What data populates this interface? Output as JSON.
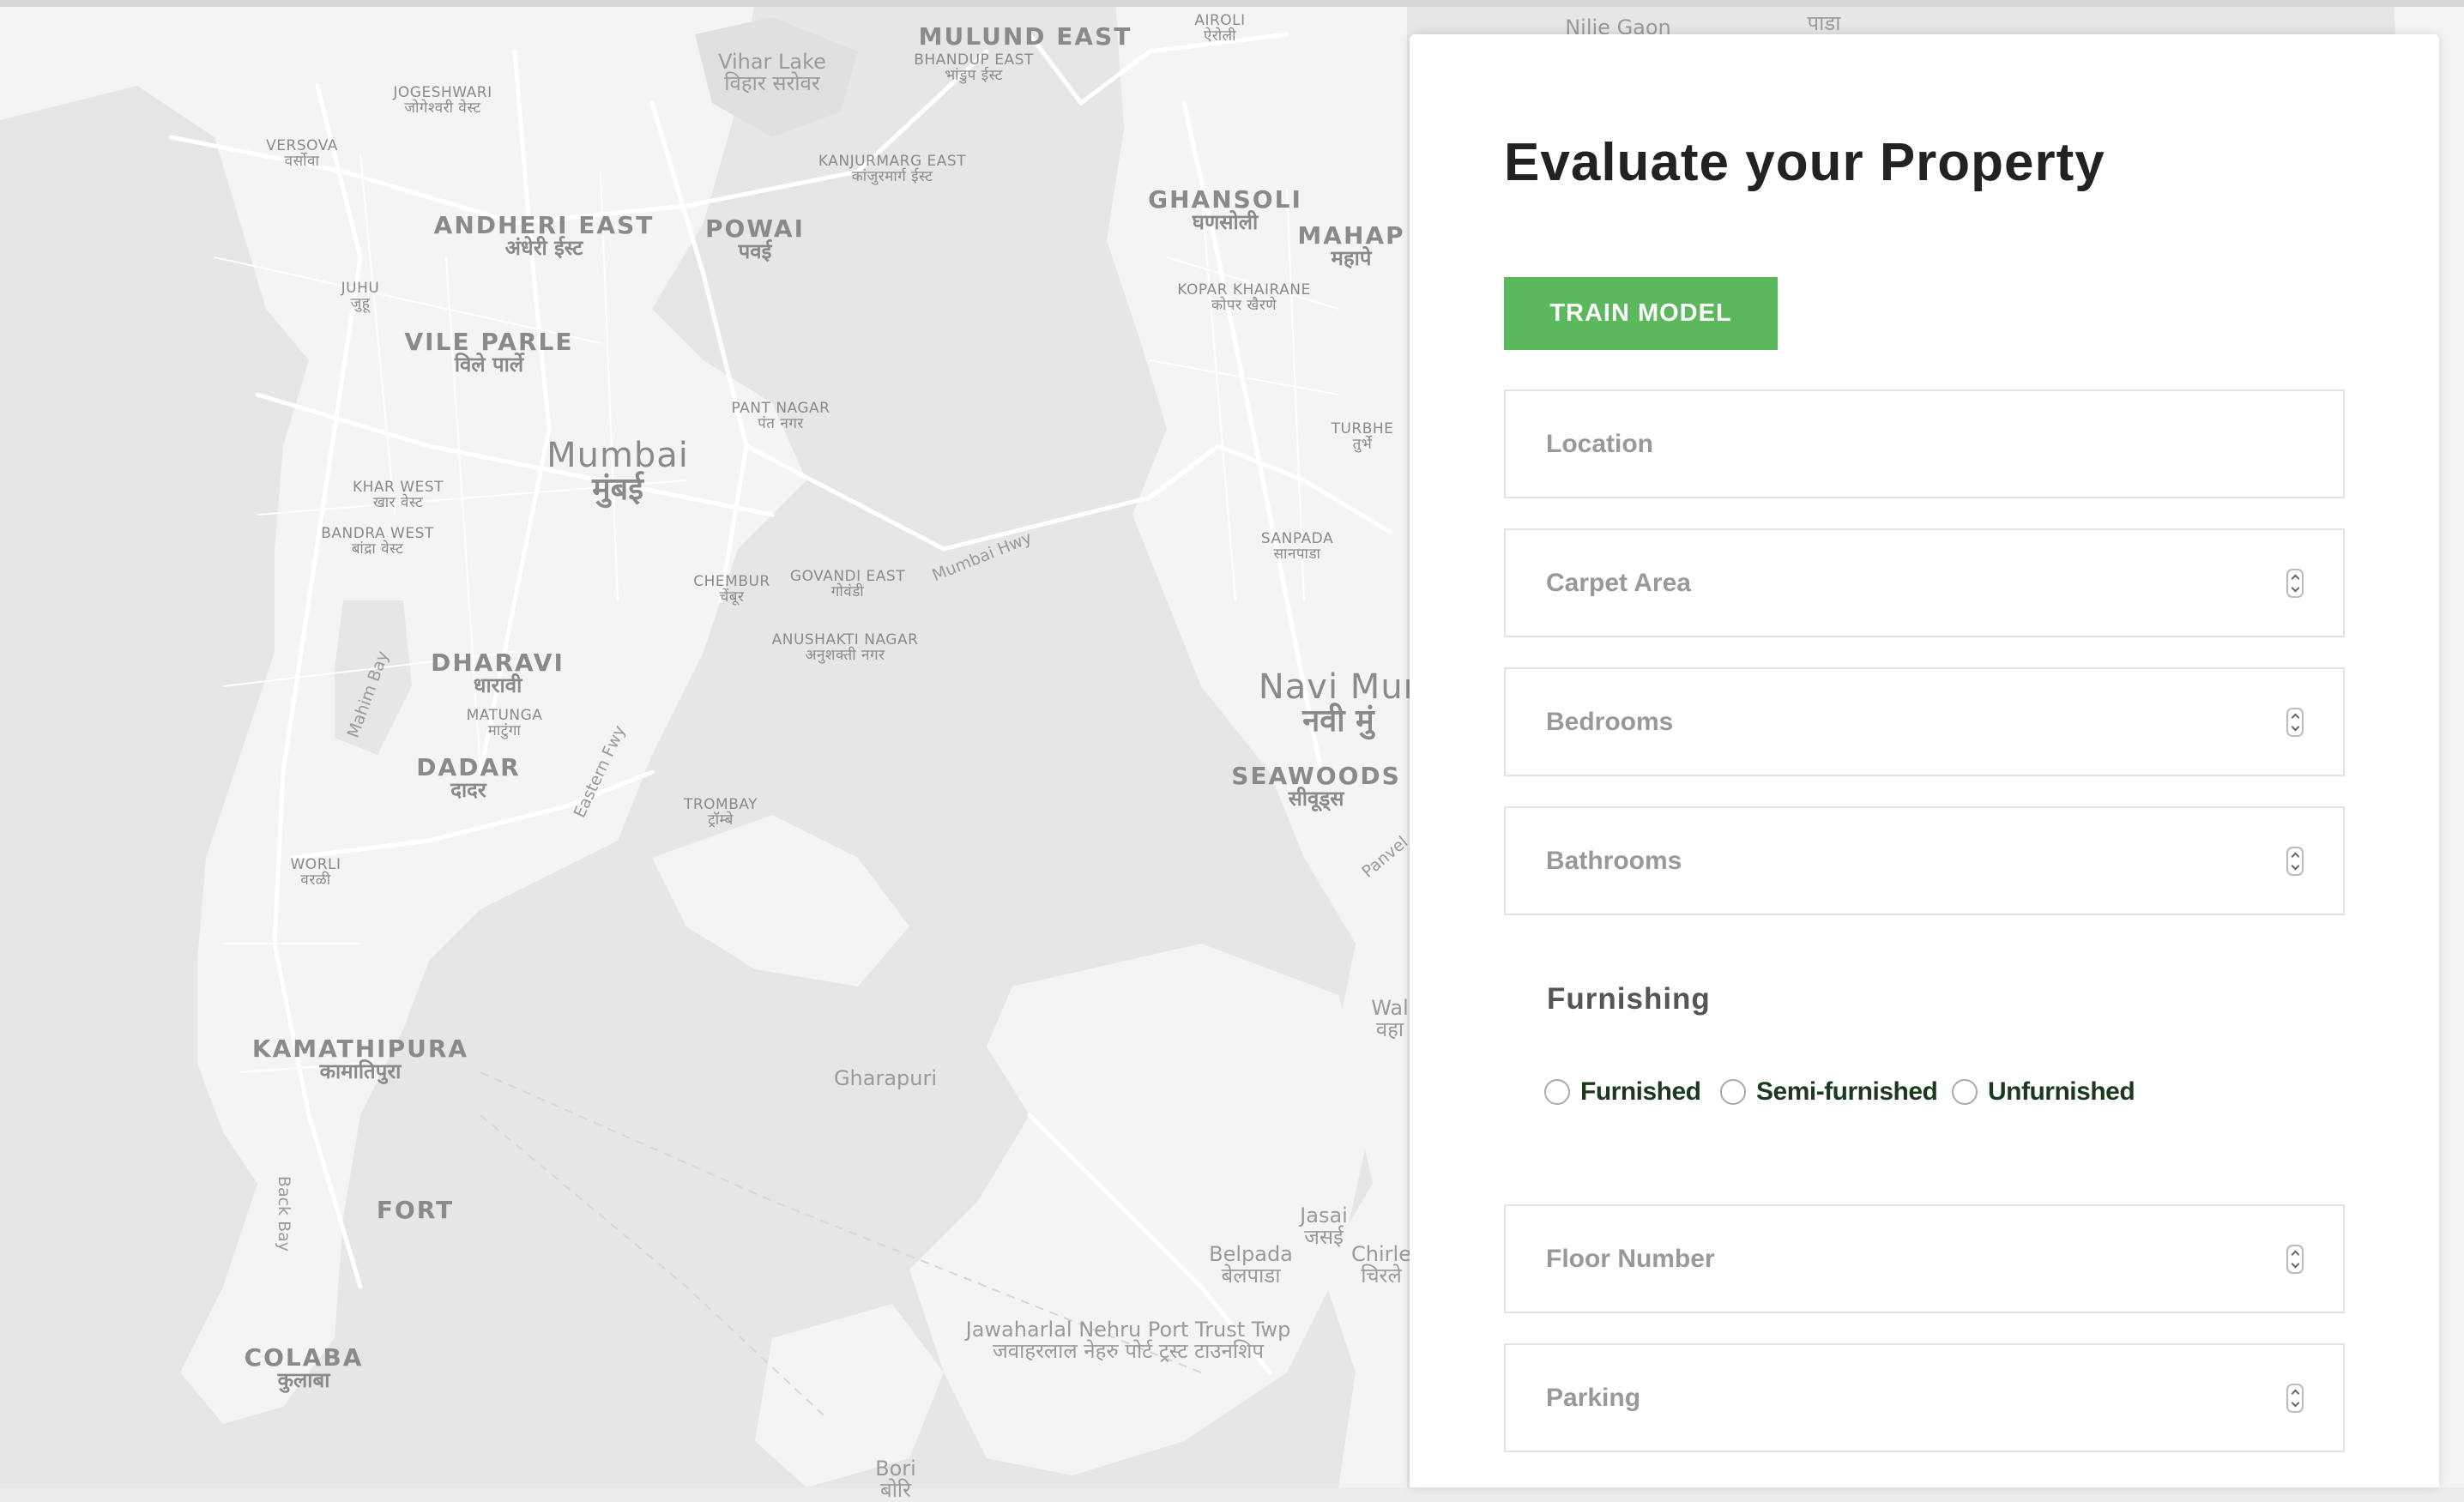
{
  "map": {
    "labels": [
      {
        "en": "Vihar Lake",
        "hi": "विहार सरोवर"
      },
      {
        "en": "MULUND EAST",
        "hi": ""
      },
      {
        "en": "BHANDUP EAST",
        "hi": "भांडुप ईस्ट"
      },
      {
        "en": "AIROLI",
        "hi": "ऐरोली"
      },
      {
        "en": "Nilje Gaon",
        "hi": ""
      },
      {
        "en": "JOGESHWARI",
        "hi": "जोगेश्वरी वेस्ट"
      },
      {
        "en": "VERSOVA",
        "hi": "वर्सोवा"
      },
      {
        "en": "KANJURMARG EAST",
        "hi": "कांजुरमार्ग ईस्ट"
      },
      {
        "en": "ANDHERI EAST",
        "hi": "अंधेरी ईस्ट"
      },
      {
        "en": "POWAI",
        "hi": "पवई"
      },
      {
        "en": "GHANSOLI",
        "hi": "घणसोली"
      },
      {
        "en": "MAHAP",
        "hi": "महापे"
      },
      {
        "en": "JUHU",
        "hi": "जुहू"
      },
      {
        "en": "KOPAR KHAIRANE",
        "hi": "कोपर खैरणे"
      },
      {
        "en": "VILE PARLE",
        "hi": "विले पार्ले"
      },
      {
        "en": "PANT NAGAR",
        "hi": "पंत नगर"
      },
      {
        "en": "Mumbai",
        "hi": "मुंबई"
      },
      {
        "en": "TURBHE",
        "hi": "तुर्भे"
      },
      {
        "en": "KHAR WEST",
        "hi": "खार वेस्ट"
      },
      {
        "en": "BANDRA WEST",
        "hi": "बांद्रा वेस्ट"
      },
      {
        "en": "SANPADA",
        "hi": "सानपाडा"
      },
      {
        "en": "CHEMBUR",
        "hi": "चेंबूर"
      },
      {
        "en": "GOVANDI EAST",
        "hi": "गोवंडी"
      },
      {
        "en": "ANUSHAKTI NAGAR",
        "hi": "अनुशक्ती नगर"
      },
      {
        "en": "DHARAVI",
        "hi": "धारावी"
      },
      {
        "en": "Navi Mur",
        "hi": "नवी मुं"
      },
      {
        "en": "MATUNGA",
        "hi": "माटुंगा"
      },
      {
        "en": "DADAR",
        "hi": "दादर"
      },
      {
        "en": "SEAWOODS",
        "hi": "सीवूड्स"
      },
      {
        "en": "TROMBAY",
        "hi": "ट्रॉम्बे"
      },
      {
        "en": "WORLI",
        "hi": "वरळी"
      },
      {
        "en": "KAMATHIPURA",
        "hi": "कामातिपुरा"
      },
      {
        "en": "Gharapuri",
        "hi": ""
      },
      {
        "en": "FORT",
        "hi": ""
      },
      {
        "en": "Jasai",
        "hi": "जसई"
      },
      {
        "en": "Belpada",
        "hi": "बेलपाडा"
      },
      {
        "en": "Chirle",
        "hi": "चिरले"
      },
      {
        "en": "COLABA",
        "hi": "कुलाबा"
      },
      {
        "en": "Jawaharlal Nehru Port Trust Twp",
        "hi": "जवाहरलाल नेहरु पोर्ट ट्रस्ट टाउनशिप"
      },
      {
        "en": "Bori",
        "hi": "बोरि"
      },
      {
        "en": "Wal",
        "hi": "वहा"
      },
      {
        "en": "पाडा",
        "hi": ""
      }
    ],
    "roads": [
      "Mumbai Hwy",
      "Eastern Fwy",
      "Mahim Bay",
      "Back Bay",
      "Panvel"
    ]
  },
  "form": {
    "title": "Evaluate your Property",
    "train_button": "TRAIN MODEL",
    "location_placeholder": "Location",
    "carpet_area_placeholder": "Carpet Area",
    "bedrooms_placeholder": "Bedrooms",
    "bathrooms_placeholder": "Bathrooms",
    "furnishing_label": "Furnishing",
    "furnishing_options": [
      "Furnished",
      "Semi-furnished",
      "Unfurnished"
    ],
    "floor_number_placeholder": "Floor Number",
    "parking_placeholder": "Parking"
  },
  "colors": {
    "accent": "#5cb85c",
    "map_land": "#f3f3f3",
    "map_water": "#e3e3e3"
  }
}
